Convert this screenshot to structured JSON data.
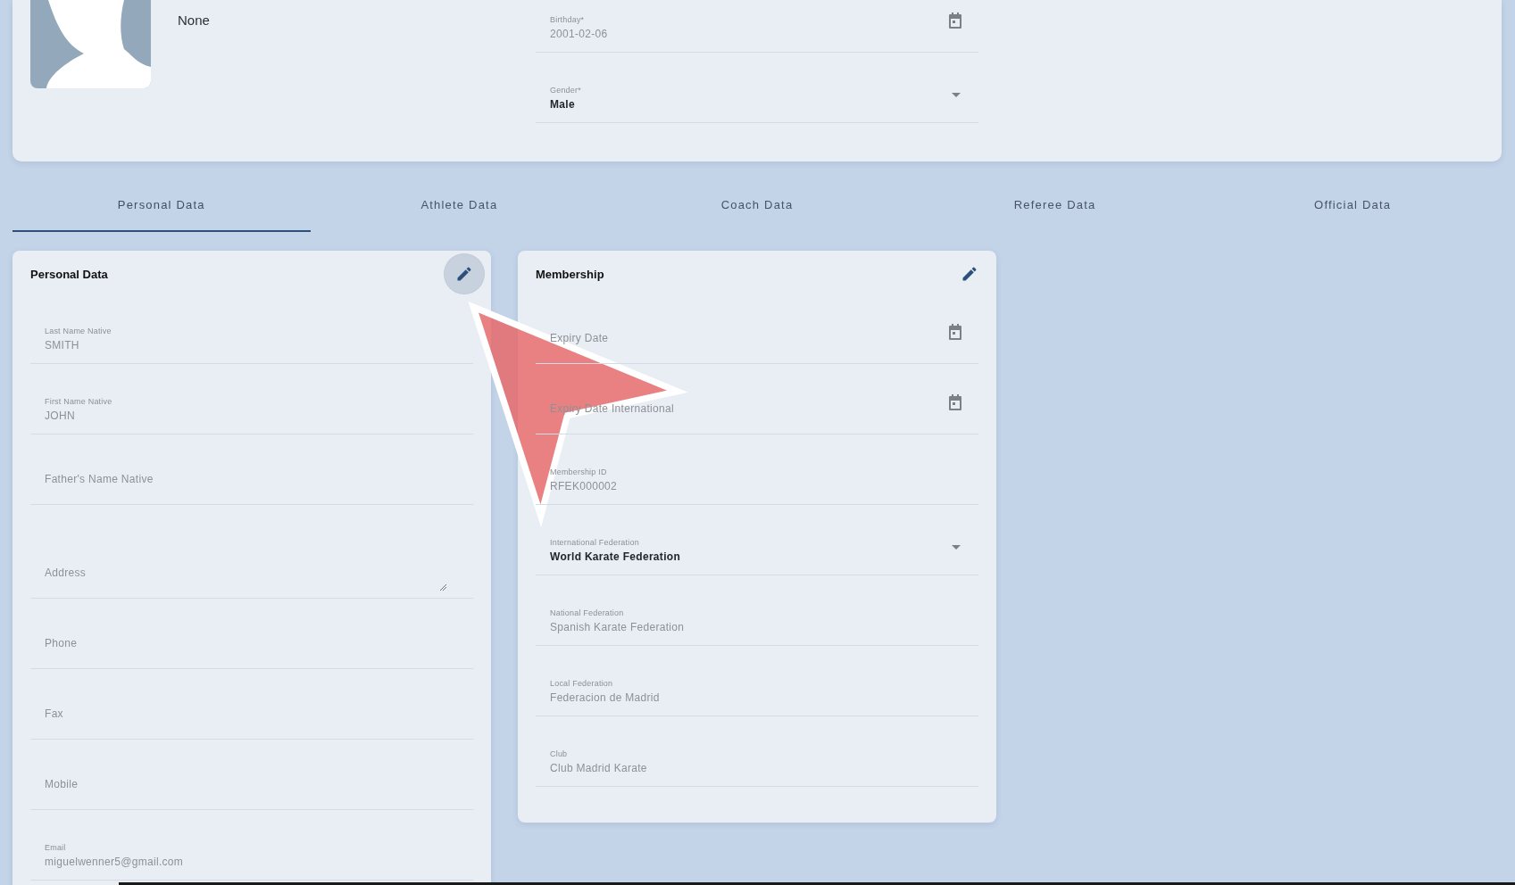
{
  "profile": {
    "category_value": "None",
    "fields": [
      {
        "kind": "date",
        "label": "Birthday*",
        "value": "2001-02-06",
        "disabled": true
      },
      {
        "kind": "select",
        "label": "Gender*",
        "value": "Male",
        "disabled": false
      }
    ]
  },
  "tabs": [
    {
      "label": "Personal Data",
      "selected": true
    },
    {
      "label": "Athlete Data",
      "selected": false
    },
    {
      "label": "Coach Data",
      "selected": false
    },
    {
      "label": "Referee Data",
      "selected": false
    },
    {
      "label": "Official Data",
      "selected": false
    }
  ],
  "cards": [
    {
      "title": "Personal Data",
      "edit_hovered": true,
      "fields": [
        {
          "kind": "text",
          "label": "Last Name Native",
          "value": "SMITH",
          "disabled": true
        },
        {
          "kind": "text",
          "label": "First Name Native",
          "value": "JOHN",
          "disabled": true
        },
        {
          "kind": "text",
          "placeholder": "Father's Name Native",
          "disabled": true
        },
        {
          "kind": "textarea",
          "placeholder": "Address",
          "disabled": true
        },
        {
          "kind": "text",
          "placeholder": "Phone",
          "disabled": true
        },
        {
          "kind": "text",
          "placeholder": "Fax",
          "disabled": true
        },
        {
          "kind": "text",
          "placeholder": "Mobile",
          "disabled": true
        },
        {
          "kind": "text",
          "label": "Email",
          "value": "miguelwenner5@gmail.com",
          "disabled": true
        }
      ]
    },
    {
      "title": "Membership",
      "edit_hovered": false,
      "fields": [
        {
          "kind": "date",
          "placeholder": "Expiry Date",
          "disabled": true
        },
        {
          "kind": "date",
          "placeholder": "Expiry Date International",
          "disabled": true
        },
        {
          "kind": "text",
          "label": "Membership ID",
          "value": "RFEK000002",
          "disabled": true
        },
        {
          "kind": "select",
          "label": "International Federation",
          "value": "World Karate Federation",
          "disabled": false
        },
        {
          "kind": "text",
          "label": "National Federation",
          "value": "Spanish Karate Federation",
          "disabled": true
        },
        {
          "kind": "text",
          "label": "Local Federation",
          "value": "Federacion de Madrid",
          "disabled": true
        },
        {
          "kind": "text",
          "label": "Club",
          "value": "Club Madrid Karate",
          "disabled": true
        }
      ]
    }
  ]
}
